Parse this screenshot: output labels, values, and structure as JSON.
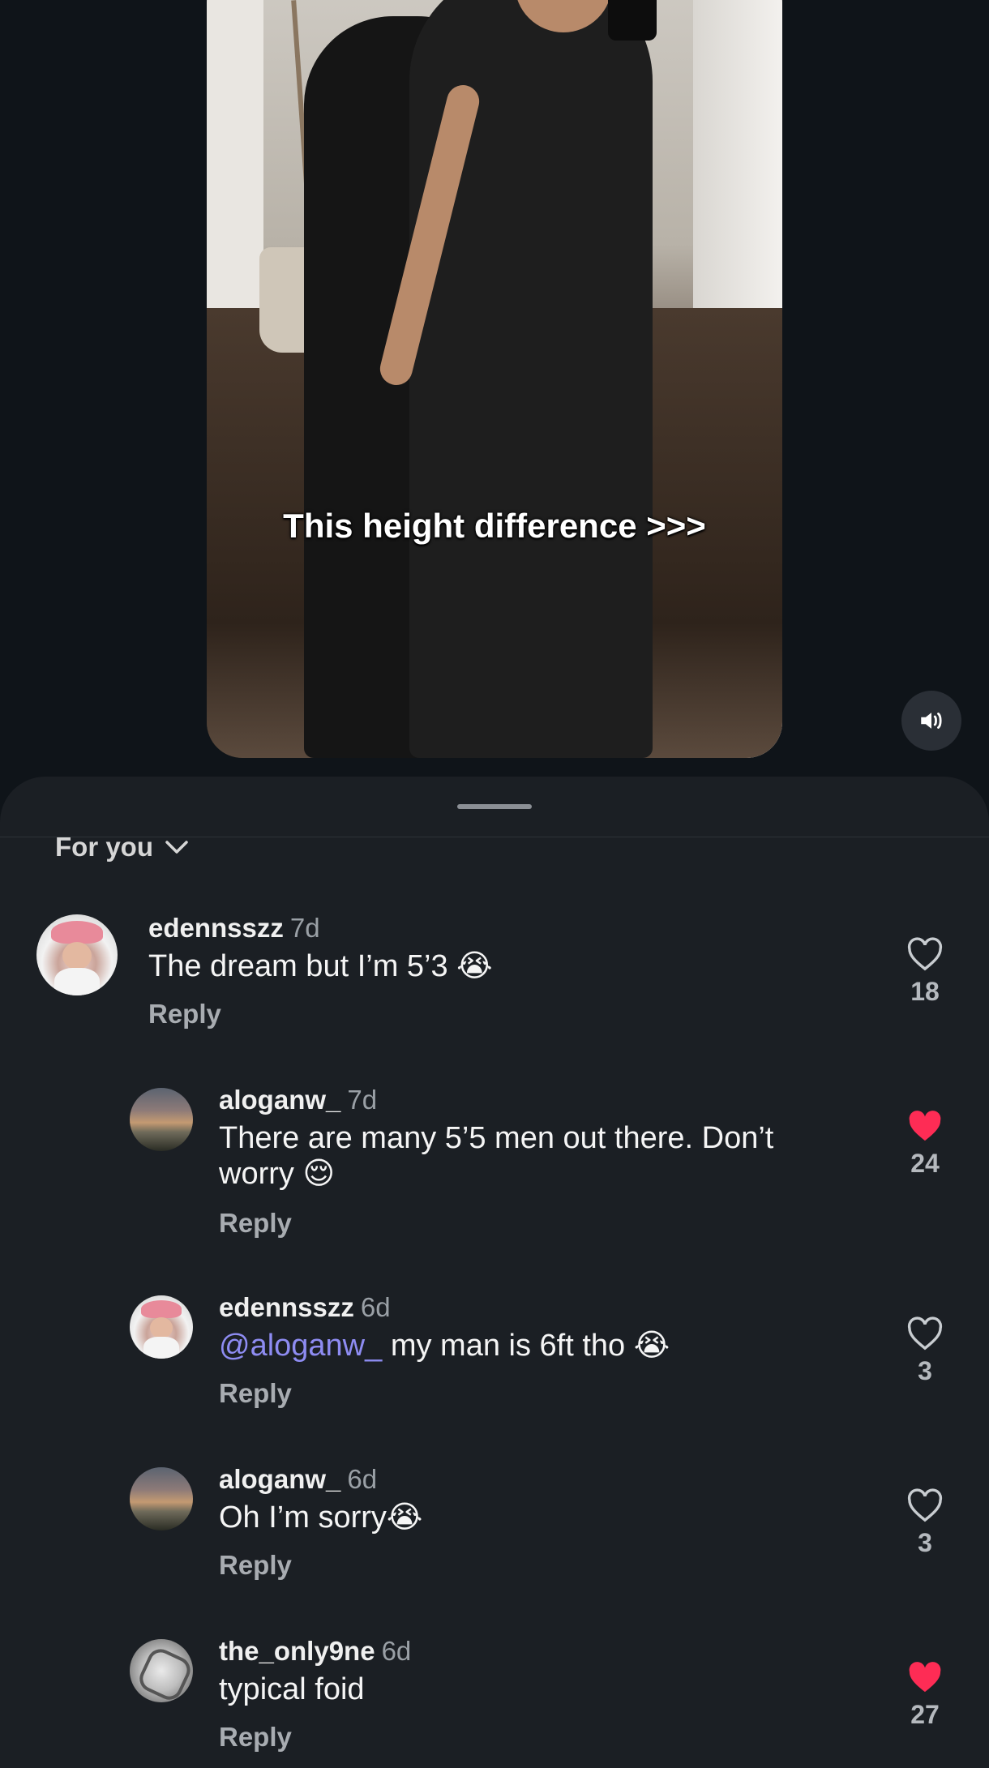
{
  "video": {
    "caption": "This height difference >>>",
    "mute_icon": "speaker-icon"
  },
  "sheet": {
    "filter_label": "For you",
    "filter_icon": "chevron-down-icon"
  },
  "comments": [
    {
      "username": "edennsszz",
      "time": "7d",
      "text": "The dream but I’m 5’3 😭",
      "reply_label": "Reply",
      "likes": "18",
      "liked": false
    },
    {
      "username": "aloganw_",
      "time": "7d",
      "text_line1": "There are many 5’5 men out there. Don’t",
      "text_line2": "worry 😌",
      "reply_label": "Reply",
      "likes": "24",
      "liked": true
    },
    {
      "username": "edennsszz",
      "time": "6d",
      "mention": "@aloganw_",
      "text": " my man is 6ft tho 😭",
      "reply_label": "Reply",
      "likes": "3",
      "liked": false
    },
    {
      "username": "aloganw_",
      "time": "6d",
      "text": "Oh I’m sorry😭",
      "reply_label": "Reply",
      "likes": "3",
      "liked": false
    },
    {
      "username": "the_only9ne",
      "time": "6d",
      "text": "typical foid",
      "reply_label": "Reply",
      "likes": "27",
      "liked": true
    }
  ],
  "colors": {
    "background": "#0f1419",
    "sheet": "#1b1f24",
    "like_active": "#fe2c55",
    "mention": "#8e8cf2"
  }
}
